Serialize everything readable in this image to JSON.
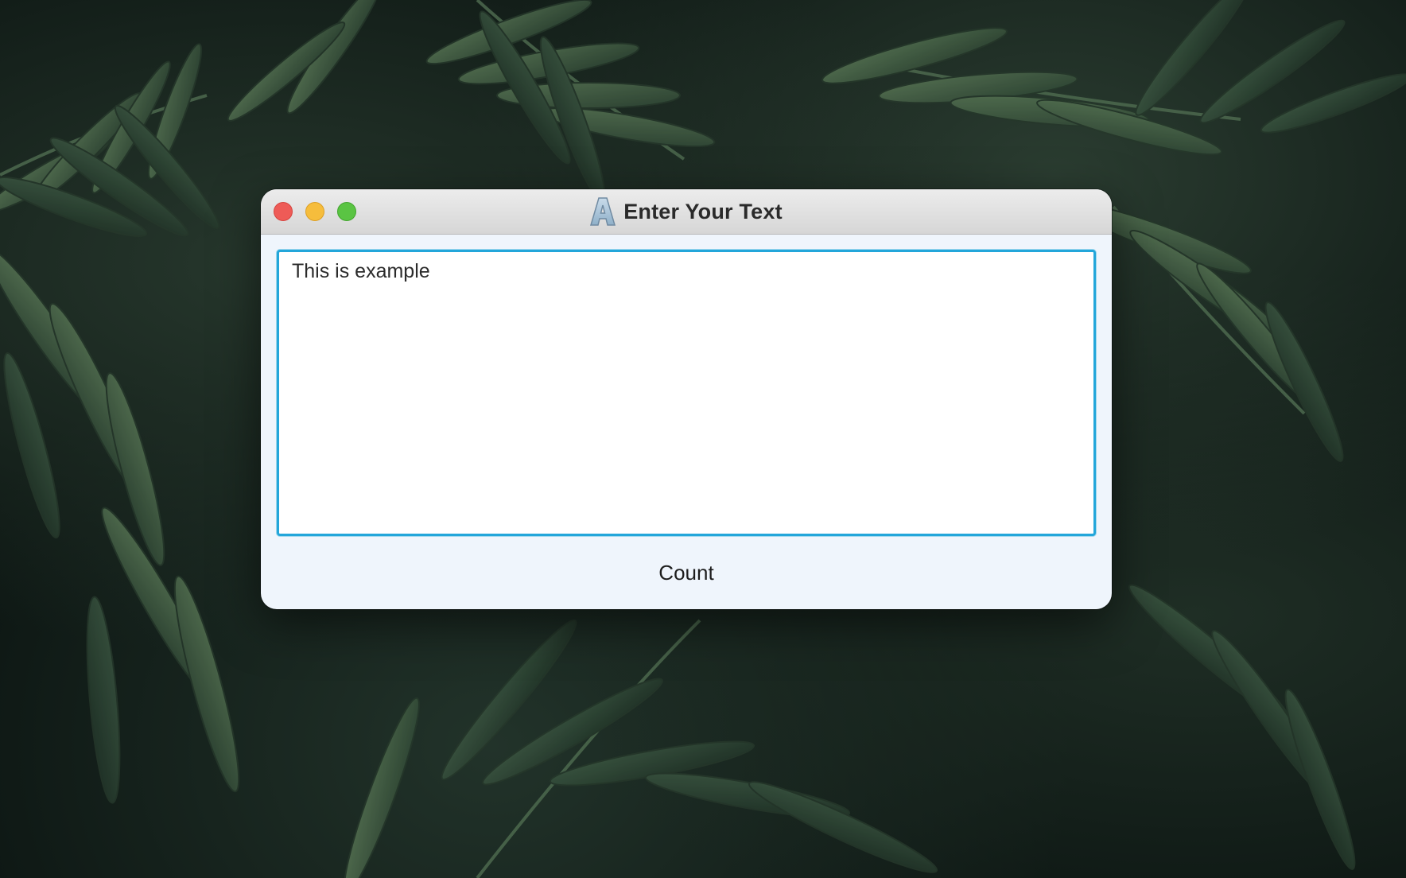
{
  "window": {
    "title": "Enter Your Text",
    "app_icon": "letter-a-icon"
  },
  "editor": {
    "text": "This is example"
  },
  "actions": {
    "count_label": "Count"
  },
  "colors": {
    "focus_ring": "#23a6da",
    "window_bg": "#eff5fc",
    "close": "#ee5b57",
    "minimize": "#f6bd3c",
    "maximize": "#5ac443"
  }
}
